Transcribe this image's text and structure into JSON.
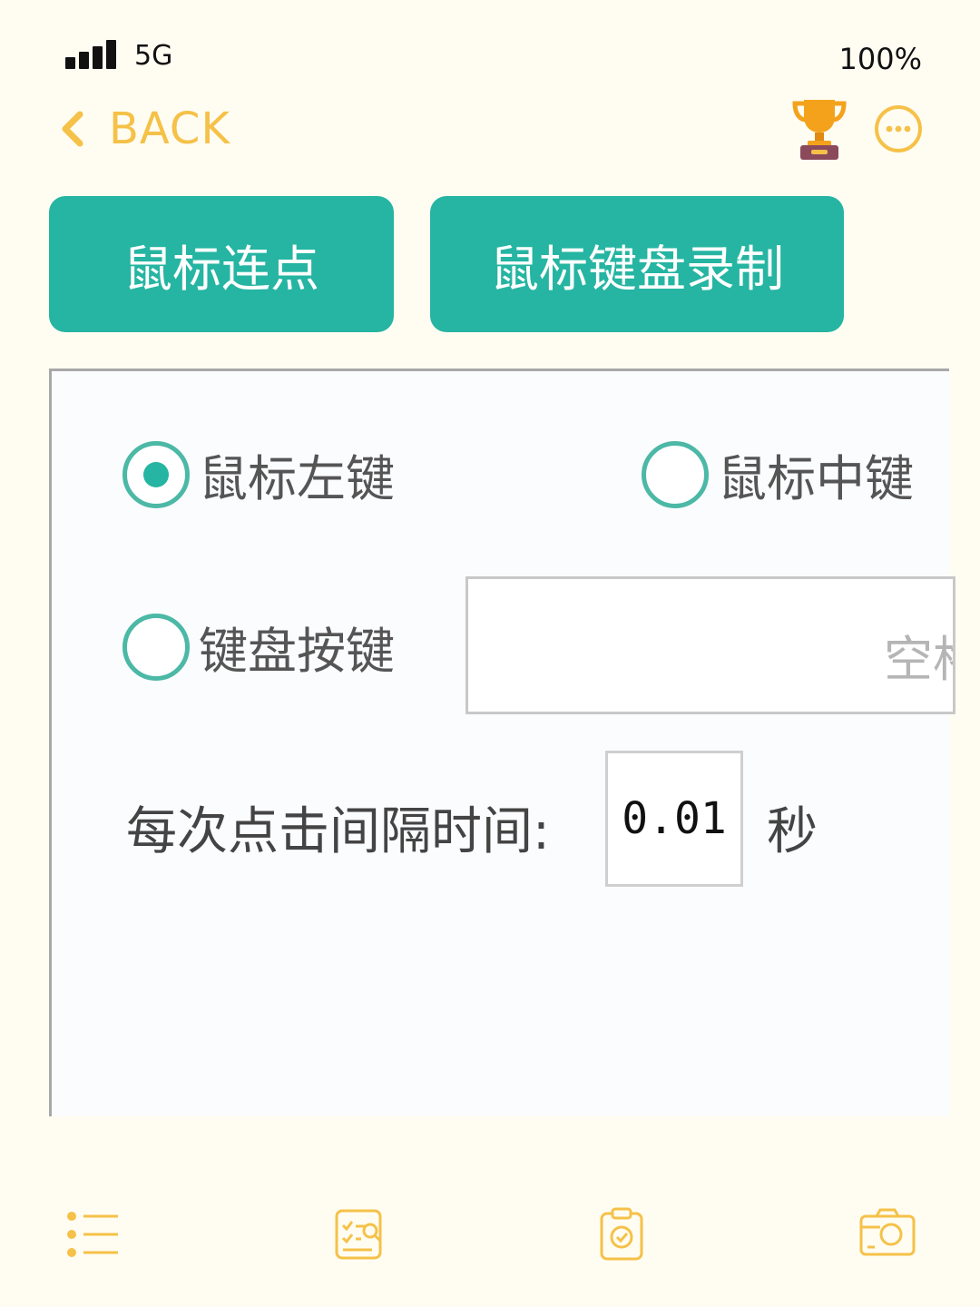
{
  "status_bar": {
    "network": "5G",
    "battery": "100%",
    "signal_icon": "signal-bars-icon"
  },
  "nav": {
    "back_label": "BACK",
    "back_icon": "chevron-left-icon",
    "trophy_icon": "trophy-icon",
    "more_icon": "more-dots-icon",
    "accent_color": "#f5c148"
  },
  "app": {
    "tabs": [
      {
        "label": "鼠标连点"
      },
      {
        "label": "鼠标键盘录制"
      }
    ],
    "tab_color": "#25b5a2",
    "options": [
      {
        "label": "鼠标左键",
        "selected": true
      },
      {
        "label": "鼠标中键",
        "selected": false
      },
      {
        "label": "键盘按键",
        "selected": false
      }
    ],
    "key_input_value": "空格",
    "interval_label": "每次点击间隔时间:",
    "interval_value": "0.01",
    "interval_unit": "秒"
  },
  "bottom_tabs": [
    {
      "icon": "list-icon"
    },
    {
      "icon": "search-checklist-icon"
    },
    {
      "icon": "clipboard-check-icon"
    },
    {
      "icon": "camera-icon"
    }
  ]
}
